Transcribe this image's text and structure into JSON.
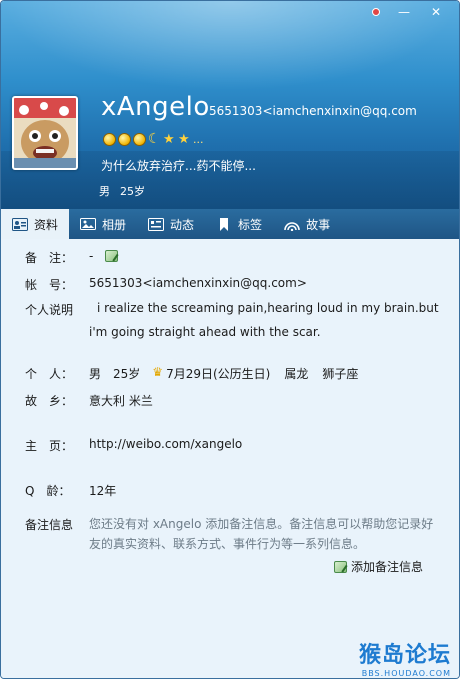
{
  "window": {
    "controls": {
      "pin_icon": "pin-icon",
      "minimize": "—",
      "close": "✕"
    }
  },
  "header": {
    "nickname": "xAngelo",
    "account": "5651303<iamchenxinxin@qq.com",
    "signature": "为什么放弃治疗...药不能停...",
    "gender": "男",
    "age": "25岁",
    "level_icons": [
      "sun",
      "sun",
      "sun",
      "moon",
      "star",
      "star"
    ],
    "level_more": "..."
  },
  "tabs": [
    {
      "label": "资料",
      "icon": "profile-card-icon",
      "active": true
    },
    {
      "label": "相册",
      "icon": "photo-album-icon",
      "active": false
    },
    {
      "label": "动态",
      "icon": "feed-icon",
      "active": false
    },
    {
      "label": "标签",
      "icon": "bookmark-tag-icon",
      "active": false
    },
    {
      "label": "故事",
      "icon": "story-icon",
      "active": false
    }
  ],
  "profile": {
    "remark": {
      "label": "备　注：",
      "value": "-"
    },
    "account": {
      "label": "帐　号：",
      "value": "5651303<iamchenxinxin@qq.com>"
    },
    "about": {
      "label": "个人说明",
      "text": "i realize the screaming pain,hearing loud in my brain.but i'm going straight ahead with the scar."
    },
    "personal": {
      "label": "个　人：",
      "gender": "男",
      "age": "25岁",
      "birthday": "7月29日(公历生日)",
      "zodiac": "属龙",
      "constellation": "狮子座"
    },
    "hometown": {
      "label": "故　乡：",
      "value": "意大利 米兰"
    },
    "homepage": {
      "label": "主　页：",
      "value": "http://weibo.com/xangelo"
    },
    "qq_age": {
      "label": "Q　龄：",
      "value": "12年"
    },
    "note_info": {
      "label": "备注信息",
      "text": "您还没有对 xAngelo 添加备注信息。备注信息可以帮助您记录好友的真实资料、联系方式、事件行为等一系列信息。",
      "add_label": "添加备注信息"
    }
  },
  "watermark": {
    "main": "猴岛论坛",
    "sub": "BBS.HOUDAO.COM"
  }
}
